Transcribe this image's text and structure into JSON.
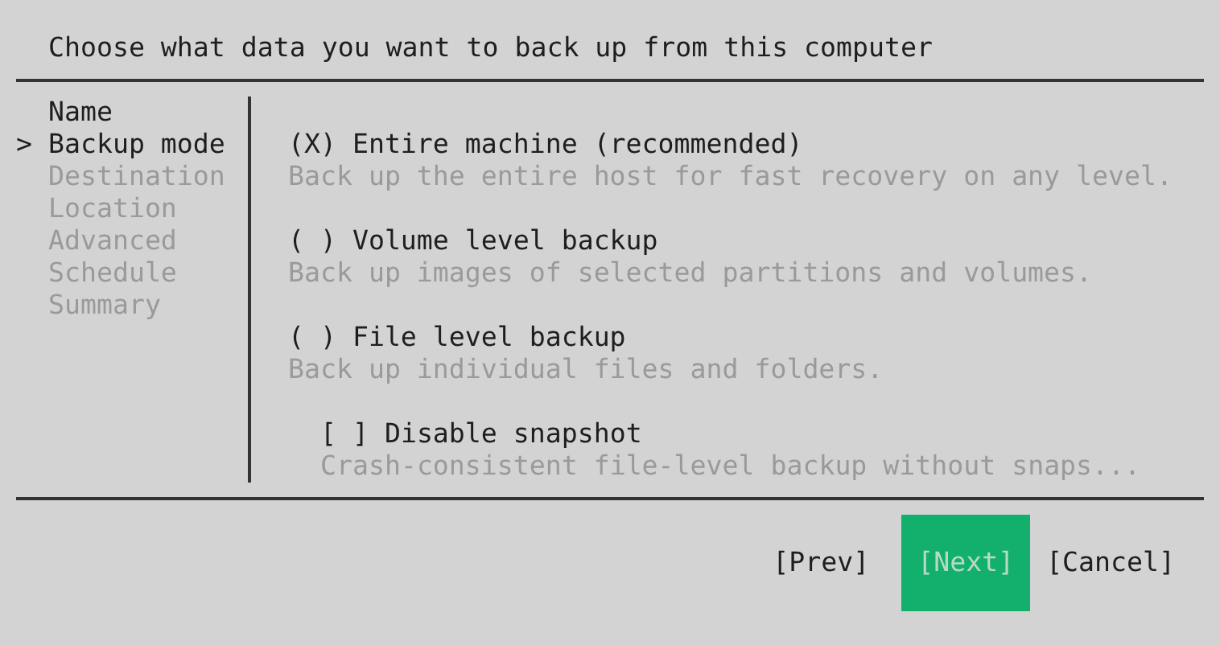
{
  "title": "Choose what data you want to back up from this computer",
  "sidebar": {
    "cursor": ">",
    "items": [
      {
        "label": "Name",
        "selected": false,
        "disabled": false
      },
      {
        "label": "Backup mode",
        "selected": true,
        "disabled": false
      },
      {
        "label": "Destination",
        "selected": false,
        "disabled": true
      },
      {
        "label": "Location",
        "selected": false,
        "disabled": true
      },
      {
        "label": "Advanced",
        "selected": false,
        "disabled": true
      },
      {
        "label": "Schedule",
        "selected": false,
        "disabled": true
      },
      {
        "label": "Summary",
        "selected": false,
        "disabled": true
      }
    ]
  },
  "options": [
    {
      "kind": "radio",
      "marker": "(X)",
      "label": "Entire machine (recommended)",
      "description": "Back up the entire host for fast recovery on any level."
    },
    {
      "kind": "radio",
      "marker": "( )",
      "label": "Volume level backup",
      "description": "Back up images of selected partitions and volumes."
    },
    {
      "kind": "radio",
      "marker": "( )",
      "label": "File level backup",
      "description": "Back up individual files and folders."
    },
    {
      "kind": "checkbox",
      "marker": "[ ]",
      "label": "Disable snapshot",
      "description": "Crash-consistent file-level backup without snaps..."
    }
  ],
  "buttons": [
    {
      "label": "[Prev]",
      "focused": false
    },
    {
      "label": "[Next]",
      "focused": true
    },
    {
      "label": "[Cancel]",
      "focused": false
    }
  ]
}
